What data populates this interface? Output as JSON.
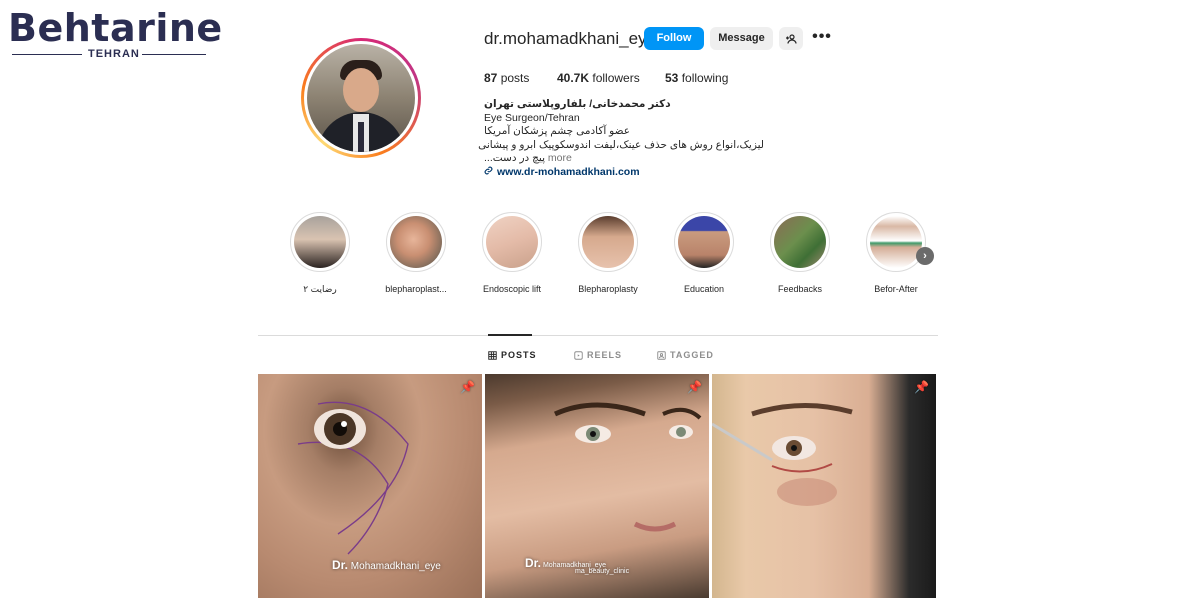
{
  "logo": {
    "word_first": "B",
    "word_rest": "ehtarine",
    "sub": "TEHRAN"
  },
  "profile": {
    "username": "dr.mohamadkhani_eye",
    "follow_label": "Follow",
    "message_label": "Message",
    "add_user_icon": "add-user-icon",
    "more_icon": "more-icon",
    "more_glyph": "•••"
  },
  "stats": {
    "posts_count": "87",
    "posts_label": "posts",
    "followers_count": "40.7K",
    "followers_label": "followers",
    "following_count": "53",
    "following_label": "following"
  },
  "bio": {
    "name": "دکتر محمدخانی/ بلفاروپلاستی تهران",
    "line1": "Eye Surgeon/Tehran",
    "line2": "عضو آکادمی چشم پزشکان آمریکا",
    "line3": "لیزیک،انواع روش های حذف عینک،لیفت اندوسکوپیک ابرو و پیشانی",
    "line4": "پیچ در دست...",
    "more": "more",
    "link": "www.dr-mohamadkhani.com"
  },
  "highlights": [
    {
      "label": "رضایت ۲"
    },
    {
      "label": "blepharoplast..."
    },
    {
      "label": "Endoscopic lift"
    },
    {
      "label": "Blepharoplasty"
    },
    {
      "label": "Education"
    },
    {
      "label": "Feedbacks"
    },
    {
      "label": "Befor-After"
    }
  ],
  "tabs": {
    "posts": "POSTS",
    "reels": "REELS",
    "tagged": "TAGGED"
  },
  "posts": {
    "wm1_prefix": "Dr.",
    "wm1_text": "Mohamadkhani_eye",
    "wm2_line1": "Mohamadkhani_eye",
    "wm2_line2": "ma_beauty_clinic",
    "wm2_prefix": "Dr."
  },
  "colors": {
    "follow_blue": "#0095f6",
    "link_blue": "#00376b",
    "brand_navy": "#2b2e52"
  }
}
